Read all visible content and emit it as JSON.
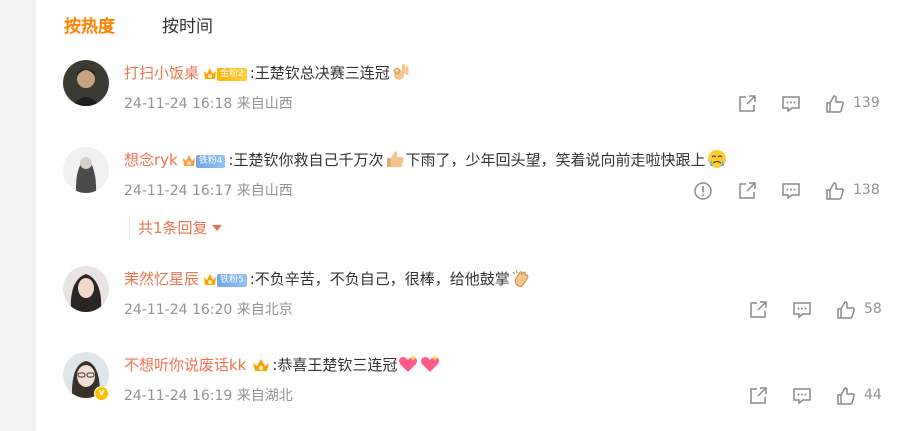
{
  "tabs": {
    "hot": "按热度",
    "time": "按时间"
  },
  "comments": [
    {
      "name": "打扫小饭桌",
      "badge": "金粉2",
      "text": ":王楚钦总决赛三连冠",
      "emoji": [
        "ok-hand-emoji"
      ],
      "time": "24-11-24 16:18",
      "location": "来自山西",
      "likes": "139"
    },
    {
      "name": "想念ryk",
      "badge": "铁粉4",
      "text_a": ":王楚钦你救自己千万次",
      "text_b": "下雨了，少年回头望，笑着说向前走啦快跟上",
      "time": "24-11-24 16:17",
      "location": "来自山西",
      "likes": "138",
      "replies": "共1条回复"
    },
    {
      "name": "茉然忆星辰",
      "badge": "铁粉5",
      "text": ":不负辛苦，不负自己，很棒，给他鼓掌",
      "time": "24-11-24 16:20",
      "location": "来自北京",
      "likes": "58"
    },
    {
      "name": "不想听你说废话kk",
      "text": ":恭喜王楚钦三连冠",
      "time": "24-11-24 16:19",
      "location": "来自湖北",
      "likes": "44",
      "verified": "v"
    }
  ],
  "colors": {
    "accent": "#ff8200",
    "username": "#eb7350",
    "meta": "#939393"
  }
}
